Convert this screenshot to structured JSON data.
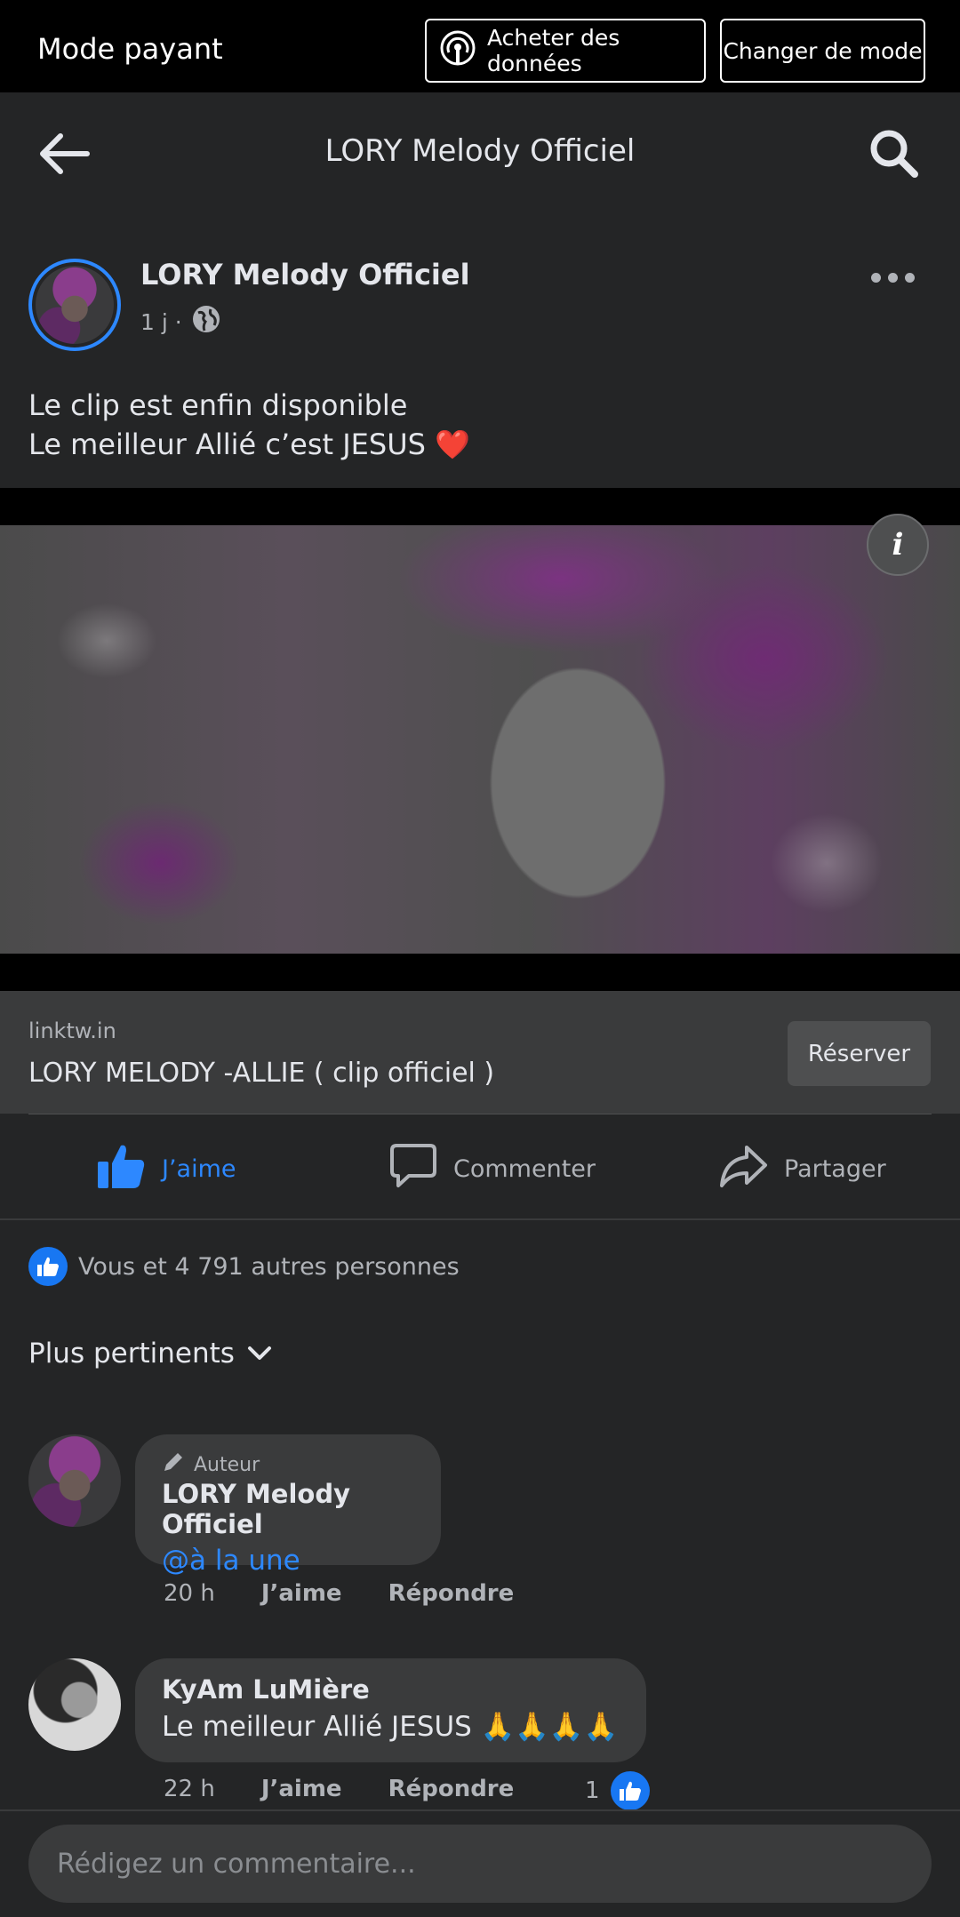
{
  "topbar": {
    "mode_label": "Mode payant",
    "buy_data_label": "Acheter des données",
    "change_mode_label": "Changer de mode"
  },
  "header": {
    "title": "LORY Melody Officiel",
    "back_icon": "arrow-left-icon",
    "search_icon": "search-icon"
  },
  "post": {
    "author": "LORY Melody Officiel",
    "time": "1 j ·",
    "privacy_icon": "globe-icon",
    "text_line1": "Le clip est enfin disponible",
    "text_line2": "Le meilleur Allié c’est JESUS",
    "emoji": "❤️"
  },
  "link_preview": {
    "domain": "linktw.in",
    "title": "LORY MELODY -ALLIE ( clip officiel )",
    "button": "Réserver"
  },
  "actions": {
    "like": "J’aime",
    "comment": "Commenter",
    "share": "Partager"
  },
  "reactions": {
    "summary": "Vous et 4 791 autres personnes"
  },
  "sort": {
    "label": "Plus pertinents"
  },
  "comments": [
    {
      "tag": "Auteur",
      "name": "LORY Melody Officiel",
      "text": "@à la une",
      "time": "20 h",
      "like": "J’aime",
      "reply": "Répondre"
    },
    {
      "name": "KyAm LuMière",
      "text": "Le meilleur Allié JESUS 🙏🙏🙏🙏",
      "time": "22 h",
      "like": "J’aime",
      "reply": "Répondre",
      "likes_count": "1"
    }
  ],
  "composer": {
    "placeholder": "Rédigez un commentaire..."
  },
  "colors": {
    "accent": "#2d88ff",
    "background": "#242526",
    "surface": "#3a3b3c"
  }
}
